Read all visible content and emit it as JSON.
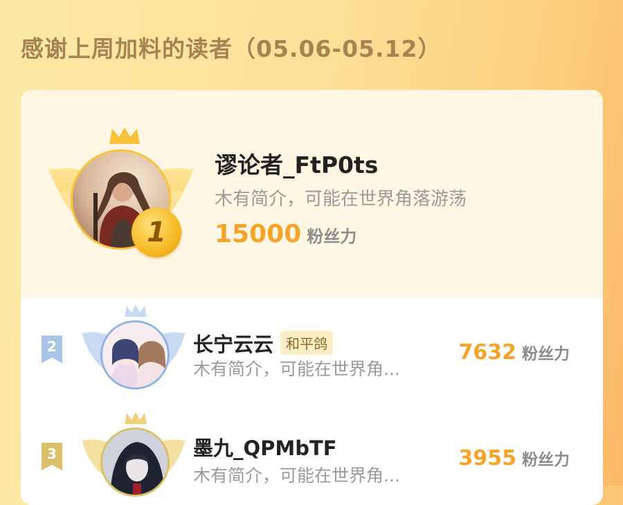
{
  "header": {
    "title": "感谢上周加料的读者（05.06-05.12）"
  },
  "colors": {
    "accent": "#f5a32a",
    "title": "#a68352",
    "gold": "#f7c23a",
    "silver": "#a9c4e6",
    "bronze": "#d9bf6a"
  },
  "fans_unit": "粉丝力",
  "leaderboard": [
    {
      "rank": "1",
      "name": "谬论者_FtP0ts",
      "desc": "木有简介，可能在世界角落游荡",
      "fans": "15000",
      "badge": ""
    },
    {
      "rank": "2",
      "name": "长宁云云",
      "desc": "木有简介，可能在世界角...",
      "fans": "7632",
      "badge": "和平鸽"
    },
    {
      "rank": "3",
      "name": "墨九_QPMbTF",
      "desc": "木有简介，可能在世界角...",
      "fans": "3955",
      "badge": ""
    }
  ]
}
